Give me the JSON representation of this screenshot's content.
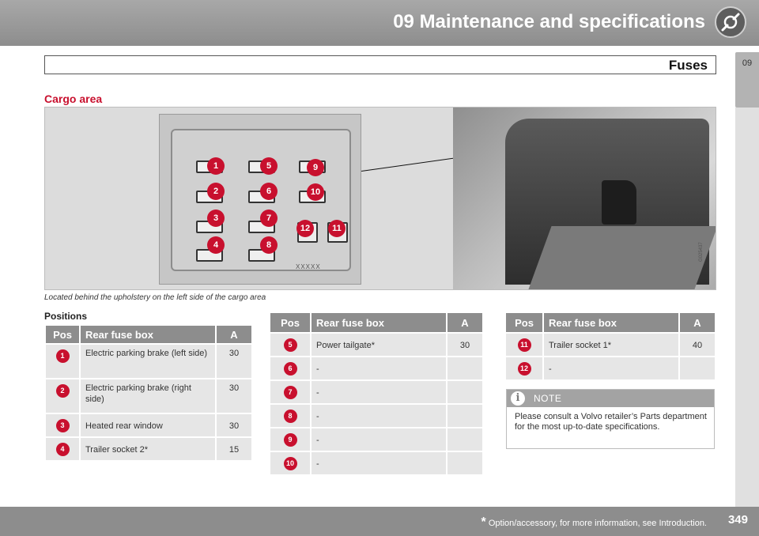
{
  "header": {
    "chapter_title": "09 Maintenance and specifications",
    "icon": "wrench-icon"
  },
  "side_tab": {
    "label": "09"
  },
  "section": {
    "title": "Fuses"
  },
  "subheading": "Cargo area",
  "illustration": {
    "fuse_labels": [
      "1",
      "2",
      "3",
      "4",
      "5",
      "6",
      "7",
      "8",
      "9",
      "10",
      "11",
      "12"
    ],
    "box_label": "XXXXX",
    "photo_code": "G025437"
  },
  "caption": "Located behind the upholstery on the left side of the cargo area",
  "positions_heading": "Positions",
  "tables": [
    {
      "headers": [
        "Pos",
        "Rear fuse box",
        "A"
      ],
      "rows": [
        {
          "pos": "1",
          "desc": "Electric parking brake (left side)",
          "amp": "30"
        },
        {
          "pos": "2",
          "desc": "Electric parking brake (right side)",
          "amp": "30"
        },
        {
          "pos": "3",
          "desc": "Heated rear window",
          "amp": "30"
        },
        {
          "pos": "4",
          "desc": "Trailer socket 2*",
          "amp": "15"
        }
      ]
    },
    {
      "headers": [
        "Pos",
        "Rear fuse box",
        "A"
      ],
      "rows": [
        {
          "pos": "5",
          "desc": "Power tailgate*",
          "amp": "30"
        },
        {
          "pos": "6",
          "desc": "-",
          "amp": ""
        },
        {
          "pos": "7",
          "desc": "-",
          "amp": ""
        },
        {
          "pos": "8",
          "desc": "-",
          "amp": ""
        },
        {
          "pos": "9",
          "desc": "-",
          "amp": ""
        },
        {
          "pos": "10",
          "desc": "-",
          "amp": ""
        }
      ]
    },
    {
      "headers": [
        "Pos",
        "Rear fuse box",
        "A"
      ],
      "rows": [
        {
          "pos": "11",
          "desc": "Trailer socket 1*",
          "amp": "40"
        },
        {
          "pos": "12",
          "desc": "-",
          "amp": ""
        }
      ]
    }
  ],
  "note": {
    "title": "NOTE",
    "icon": "info-icon",
    "text": "Please consult a Volvo retailer’s Parts department for the most up-to-date specifications."
  },
  "footer": {
    "asterisk": "*",
    "footnote": "Option/accessory, for more information, see Introduction.",
    "page_number": "349"
  },
  "colors": {
    "accent_red": "#c8102e",
    "header_gray": "#8d8d8d",
    "table_cell": "#e6e6e6"
  }
}
